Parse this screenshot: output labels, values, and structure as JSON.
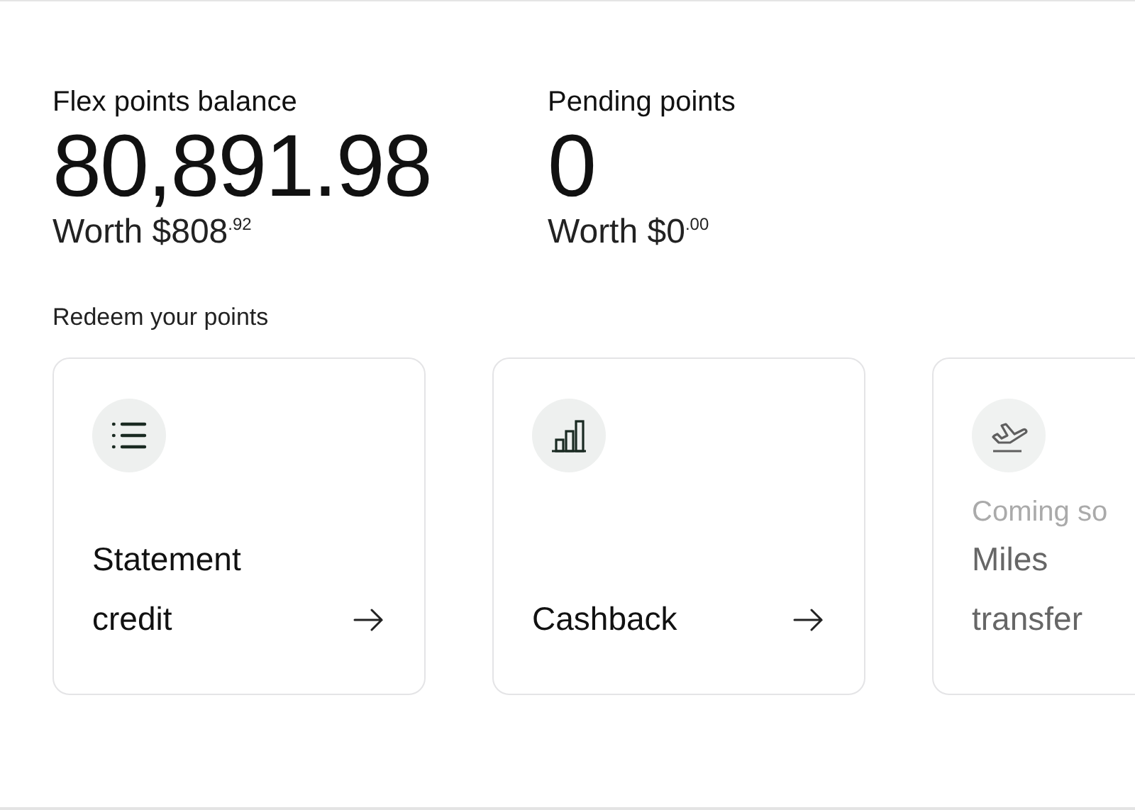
{
  "balances": [
    {
      "label": "Flex points balance",
      "value": "80,891.98",
      "worth": "Worth $808$^{.92}$"
    },
    {
      "label": "Pending points",
      "value": "0",
      "worth": "Worth $0$^{.00}$"
    }
  ],
  "redeem": {
    "heading": "Redeem your points",
    "options": [
      {
        "kind": "list",
        "title": "Statement credit",
        "disabled": false
      },
      {
        "kind": "chart",
        "title": "Cashback",
        "disabled": false
      },
      {
        "kind": "plane",
        "note": "Coming so",
        "title": "Miles transfer",
        "disabled": true
      }
    ]
  }
}
